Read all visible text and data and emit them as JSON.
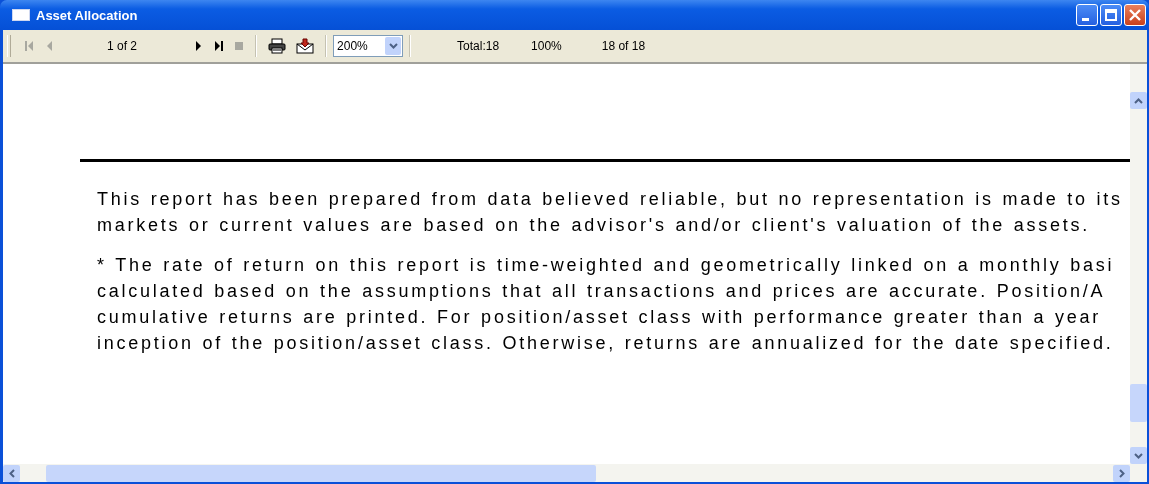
{
  "window": {
    "title": "Asset Allocation"
  },
  "toolbar": {
    "nav_buttons": [
      {
        "kind": "first",
        "disabled": true
      },
      {
        "kind": "prev",
        "disabled": true
      }
    ],
    "page": "1 of 2",
    "nav_buttons_2": [
      {
        "kind": "next",
        "disabled": false
      },
      {
        "kind": "last",
        "disabled": false
      },
      {
        "kind": "stop",
        "disabled": true
      }
    ],
    "tools": [
      {
        "kind": "print"
      },
      {
        "kind": "export"
      }
    ],
    "zoom": {
      "value": "200%"
    },
    "total": "Total:18",
    "percent": "100%",
    "records": "18 of 18"
  },
  "report": {
    "paragraphs": [
      [
        "This report has been prepared from data believed reliable, but no representation is made to its",
        "markets or current values are based on the advisor's and/or client's valuation of the assets."
      ],
      [
        "*  The rate of return on this report is time-weighted and geometrically linked on a monthly basi",
        "calculated based on the assumptions that all transactions and prices are accurate.  Position/A",
        "cumulative returns are printed.  For position/asset class with performance greater than a year",
        "inception of the position/asset class.  Otherwise, returns are annualized for the date specified."
      ]
    ]
  }
}
